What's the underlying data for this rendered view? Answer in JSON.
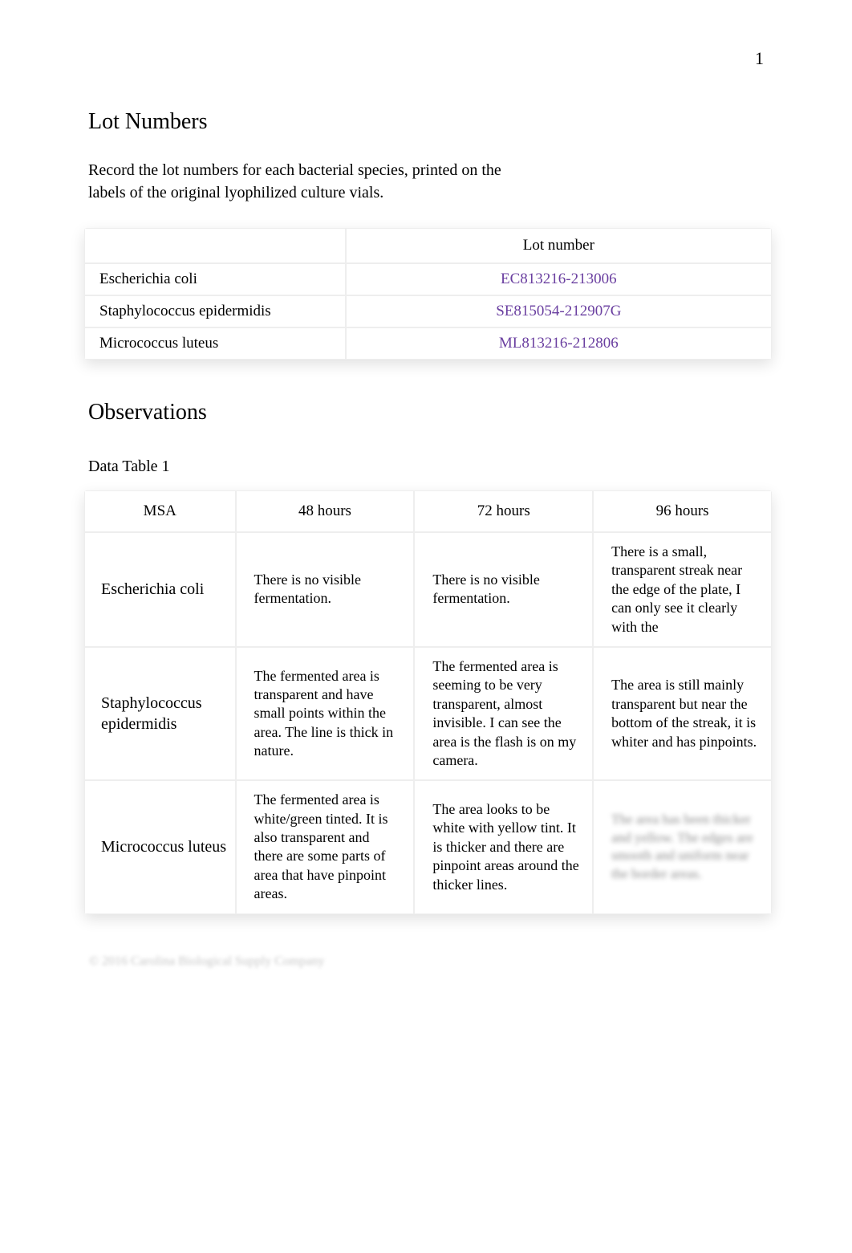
{
  "page_number": "1",
  "sections": {
    "lot": {
      "heading": "Lot Numbers",
      "intro": "Record the lot numbers for each bacterial species, printed on the labels of the original lyophilized culture vials.",
      "header_blank": "",
      "header_lot": "Lot number",
      "rows": [
        {
          "species": "Escherichia coli",
          "lot": "EC813216-213006"
        },
        {
          "species": "Staphylococcus epidermidis",
          "lot": "SE815054-212907G"
        },
        {
          "species": "Micrococcus luteus",
          "lot": "ML813216-212806"
        }
      ]
    },
    "observations": {
      "heading": "Observations",
      "subheading": "Data Table 1",
      "headers": {
        "col0": "MSA",
        "col1": "48 hours",
        "col2": "72 hours",
        "col3": "96 hours"
      },
      "rows": [
        {
          "label": "Escherichia coli",
          "h48": "There is no visible fermentation.",
          "h72": "There is no visible fermentation.",
          "h96": "There is a small, transparent streak near the edge of the plate, I can only see it clearly with the"
        },
        {
          "label": "Staphylococcus epidermidis",
          "h48": "The fermented area is transparent and have small points within the area. The line is thick in nature.",
          "h72": "The fermented area is seeming to be very transparent, almost invisible. I can see the area is the flash is on my camera.",
          "h96": "The area is still mainly transparent but near the bottom of the streak, it is whiter and has pinpoints."
        },
        {
          "label": "Micrococcus luteus",
          "h48": "The fermented area is white/green tinted. It is also transparent and there are some parts of area that have pinpoint areas.",
          "h72": "The area looks to be white with yellow tint. It is thicker and there are pinpoint areas around the thicker lines.",
          "h96_redacted": "The area has been thicker and yellow. The edges are smooth and uniform near the border areas."
        }
      ]
    }
  },
  "footer_text": "© 2016 Carolina Biological Supply Company"
}
